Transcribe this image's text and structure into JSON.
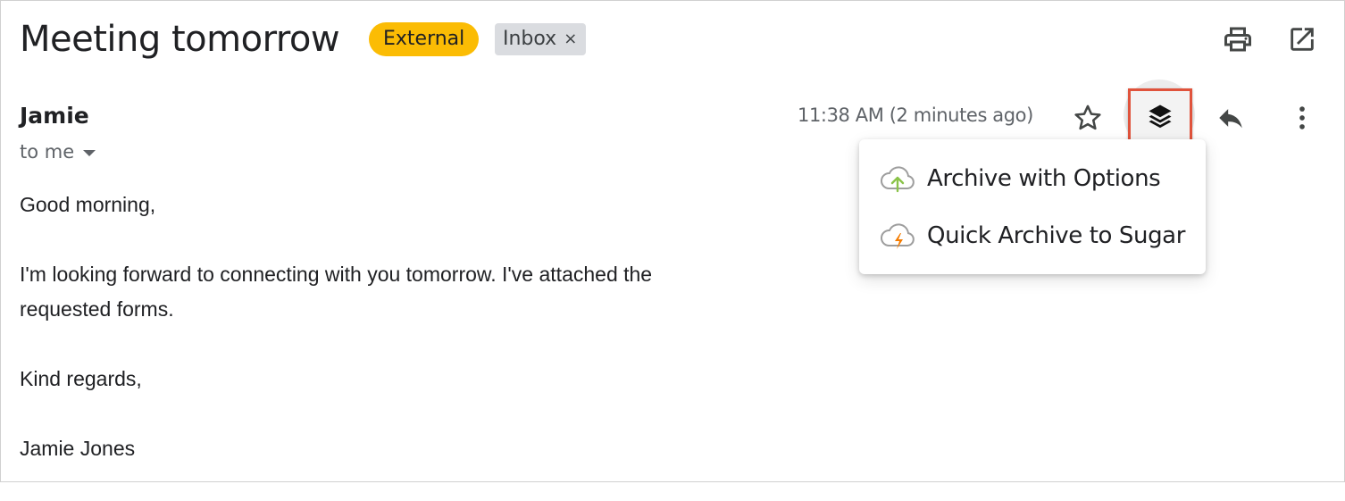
{
  "email": {
    "subject": "Meeting tomorrow",
    "labels": {
      "external": "External",
      "inbox": "Inbox",
      "remove_symbol": "×"
    },
    "sender": "Jamie",
    "recipient_text": "to me",
    "timestamp": "11:38 AM (2 minutes ago)",
    "body": {
      "greeting": "Good morning,",
      "paragraph_line1": "I'm looking forward to connecting with you tomorrow. I've attached the",
      "paragraph_line2": "requested forms.",
      "closing": "Kind regards,",
      "signature": "Jamie Jones"
    }
  },
  "toolbar": {
    "top_icons": [
      "print-icon",
      "open-in-new-window-icon"
    ],
    "action_icons": [
      "star-icon",
      "sugar-layers-icon",
      "reply-icon",
      "more-vert-icon"
    ]
  },
  "sugar_menu": {
    "items": [
      {
        "label": "Archive with Options",
        "icon": "cloud-upload-icon",
        "icon_color": "#8bc34a"
      },
      {
        "label": "Quick Archive to Sugar",
        "icon": "cloud-lightning-icon",
        "icon_color": "#f57c00"
      }
    ]
  },
  "colors": {
    "external_badge": "#fbbc04",
    "inbox_badge": "#dadce0",
    "highlight_border": "#e0533c"
  }
}
